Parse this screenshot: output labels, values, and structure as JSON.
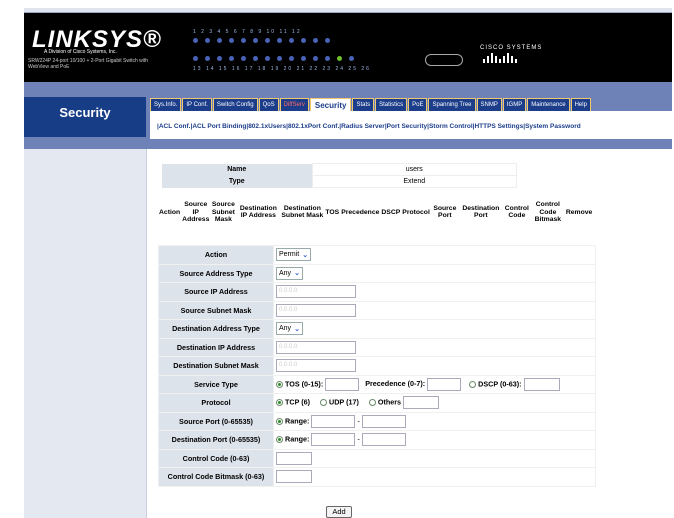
{
  "brand": {
    "logo": "LINKSYS®",
    "logo_sub": "A Division of Cisco Systems, Inc.",
    "product_desc": "SRW224P 24-port 10/100 + 2-Port Gigabit Switch with WebView and PoE",
    "cisco": "CISCO SYSTEMS",
    "port_numbers_top": "1 2 3 4   5 6 7 8   9 10 11 12",
    "port_numbers_bottom": "13 14 15 16   17 18 19 20   21 22 23 24   25 26"
  },
  "page": {
    "section_title": "Security"
  },
  "tabs": [
    {
      "label": "Sys.Info."
    },
    {
      "label": "IP Conf."
    },
    {
      "label": "Switch Config"
    },
    {
      "label": "QoS"
    },
    {
      "label": "DiffServ"
    },
    {
      "label": "Security"
    },
    {
      "label": "Stats"
    },
    {
      "label": "Statistics"
    },
    {
      "label": "PoE"
    },
    {
      "label": "Spanning Tree"
    },
    {
      "label": "SNMP"
    },
    {
      "label": "IGMP"
    },
    {
      "label": "Maintenance"
    },
    {
      "label": "Help"
    }
  ],
  "subnav": [
    "ACL Conf.",
    "ACL Port Binding",
    "802.1xUsers",
    "802.1xPort Conf.",
    "Radius Server",
    "Port Security",
    "Storm Control",
    "HTTPS Settings",
    "System Password"
  ],
  "name_type": {
    "name_label": "Name",
    "name_value": "users",
    "type_label": "Type",
    "type_value": "Extend"
  },
  "rule_columns": [
    "Action",
    "Source IP Address",
    "Source Subnet Mask",
    "Destination IP Address",
    "Destination Subnet Mask",
    "TOS",
    "Precedence",
    "DSCP",
    "Protocol",
    "Source Port",
    "Destination Port",
    "Control Code",
    "Control Code Bitmask",
    "Remove"
  ],
  "form": {
    "action_label": "Action",
    "action_value": "Permit",
    "src_type_label": "Source Address Type",
    "src_type_value": "Any",
    "src_ip_label": "Source IP Address",
    "src_ip_placeholder": "0.0.0.0",
    "src_mask_label": "Source Subnet Mask",
    "src_mask_placeholder": "0.0.0.0",
    "dst_type_label": "Destination Address Type",
    "dst_type_value": "Any",
    "dst_ip_label": "Destination IP Address",
    "dst_ip_placeholder": "0.0.0.0",
    "dst_mask_label": "Destination Subnet Mask",
    "dst_mask_placeholder": "0.0.0.0",
    "service_label": "Service Type",
    "tos_label": "TOS (0-15):",
    "prec_label": "Precedence (0-7):",
    "dscp_label": "DSCP (0-63):",
    "protocol_label": "Protocol",
    "tcp_label": "TCP (6)",
    "udp_label": "UDP (17)",
    "others_label": "Others",
    "src_port_label": "Source Port (0-65535)",
    "dst_port_label": "Destination Port (0-65535)",
    "range_label": "Range:",
    "range_sep": "-",
    "ctrl_code_label": "Control Code (0-63)",
    "ctrl_mask_label": "Control Code Bitmask (0-63)"
  },
  "add_button": "Add"
}
